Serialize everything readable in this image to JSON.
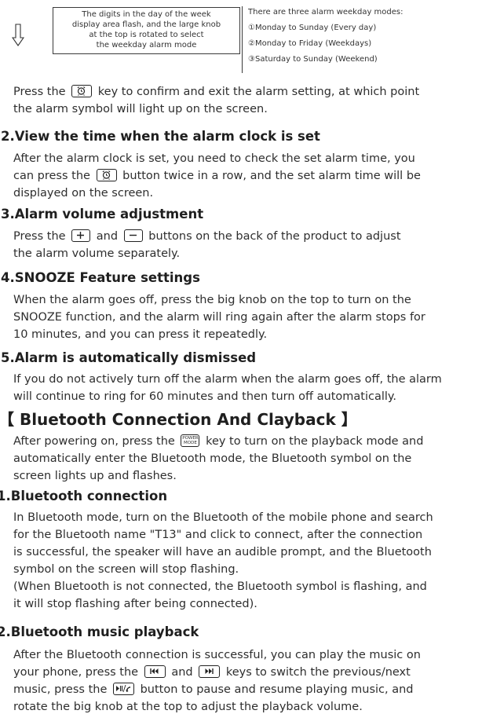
{
  "diagram": {
    "flash_note_lines": [
      "The digits in the day of the week",
      "display area flash, and the large knob",
      "at the top is rotated to select",
      "the weekday alarm mode"
    ],
    "modes_title": "There are three alarm weekday modes:",
    "modes": [
      "①Monday to Sunday (Every day)",
      "②Monday to Friday (Weekdays)",
      "③Saturday to Sunday (Weekend)"
    ]
  },
  "confirm": {
    "l1_a": "Press the",
    "l1_b": "key to confirm and exit the alarm setting, at which point",
    "l2": "the alarm symbol will light up on the screen."
  },
  "s2": {
    "heading": "2.View the time when the alarm clock is set",
    "l1": "After the alarm clock is set, you need to check the set alarm time, you",
    "l2_a": "can press the",
    "l2_b": "button twice in a row, and the set alarm time will be",
    "l3": "displayed on the screen."
  },
  "s3": {
    "heading": "3.Alarm volume adjustment",
    "l1_a": "Press the",
    "l1_b": "and",
    "l1_c": "buttons on the back of the product to adjust",
    "l2": "the alarm volume separately."
  },
  "s4": {
    "heading": "4.SNOOZE Feature settings",
    "l1": "When the alarm goes off, press the big knob on the top to turn on the",
    "l2": "SNOOZE function, and the alarm will ring again after the alarm stops for",
    "l3": "10 minutes, and you can press it repeatedly."
  },
  "s5": {
    "heading": "5.Alarm is automatically dismissed",
    "l1": "If you do not actively turn off the alarm when the alarm goes off, the alarm",
    "l2": "will continue to ring for 60 minutes and then turn off automatically."
  },
  "bt": {
    "heading": "【 Bluetooth Connection And Clayback 】",
    "l1_a": "After powering on, press the",
    "l1_b": "key to turn on the playback mode and",
    "l2": "automatically enter the Bluetooth mode, the Bluetooth symbol on the",
    "l3": "screen lights up and flashes.",
    "power_key_top": "POWER",
    "power_key_bottom": "MODE"
  },
  "b1": {
    "heading": "1.Bluetooth connection",
    "l1": "In Bluetooth mode, turn on the Bluetooth of the mobile phone and search",
    "l2": "for the Bluetooth name \"T13\" and click to connect, after the connection",
    "l3": "is successful, the speaker will have an audible prompt, and the Bluetooth",
    "l4": "symbol on the screen will stop flashing.",
    "l5": "(When Bluetooth is not connected, the Bluetooth symbol is flashing, and",
    "l6": "it will stop flashing after being connected)."
  },
  "b2": {
    "heading": "2.Bluetooth music playback",
    "l1": "After the Bluetooth connection is successful, you can play the music on",
    "l2_a": "your phone, press the",
    "l2_b": "and",
    "l2_c": "keys to switch the previous/next",
    "l3_a": "music, press the",
    "l3_b": "button to pause and resume playing music, and",
    "l4": "rotate the big knob at the top to adjust the playback volume."
  }
}
